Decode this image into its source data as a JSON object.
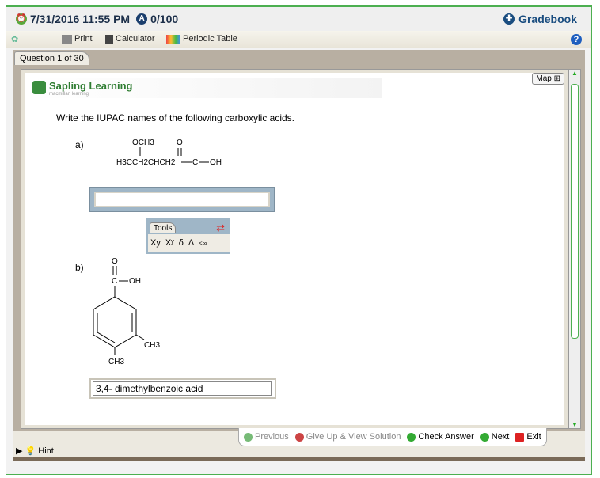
{
  "header": {
    "due_date": "7/31/2016 11:55 PM",
    "score": "0/100",
    "gradebook": "Gradebook"
  },
  "toolbar": {
    "print": "Print",
    "calculator": "Calculator",
    "periodic_table": "Periodic Table",
    "help": "?"
  },
  "question_tab": "Question 1 of 30",
  "logo": {
    "title": "Sapling Learning",
    "subtitle": "macmillan learning"
  },
  "map_label": "Map",
  "question": "Write the IUPAC names of the following carboxylic acids.",
  "part_a": {
    "label": "a)",
    "och3": "OCH3",
    "o": "O",
    "chain": "H3CCH2CHCH2",
    "c": "C",
    "oh": "OH",
    "answer": ""
  },
  "tools": {
    "title": "Tools",
    "items": [
      "Xy",
      "Xʸ",
      "δ",
      "Δ",
      "≤∞"
    ]
  },
  "part_b": {
    "label": "b)",
    "o": "O",
    "c": "C",
    "oh": "OH",
    "ch3_meta": "CH3",
    "ch3_para": "CH3",
    "answer": "3,4- dimethylbenzoic acid"
  },
  "footer": {
    "hint": "Hint",
    "previous": "Previous",
    "give_up": "Give Up & View Solution",
    "check": "Check Answer",
    "next": "Next",
    "exit": "Exit"
  }
}
